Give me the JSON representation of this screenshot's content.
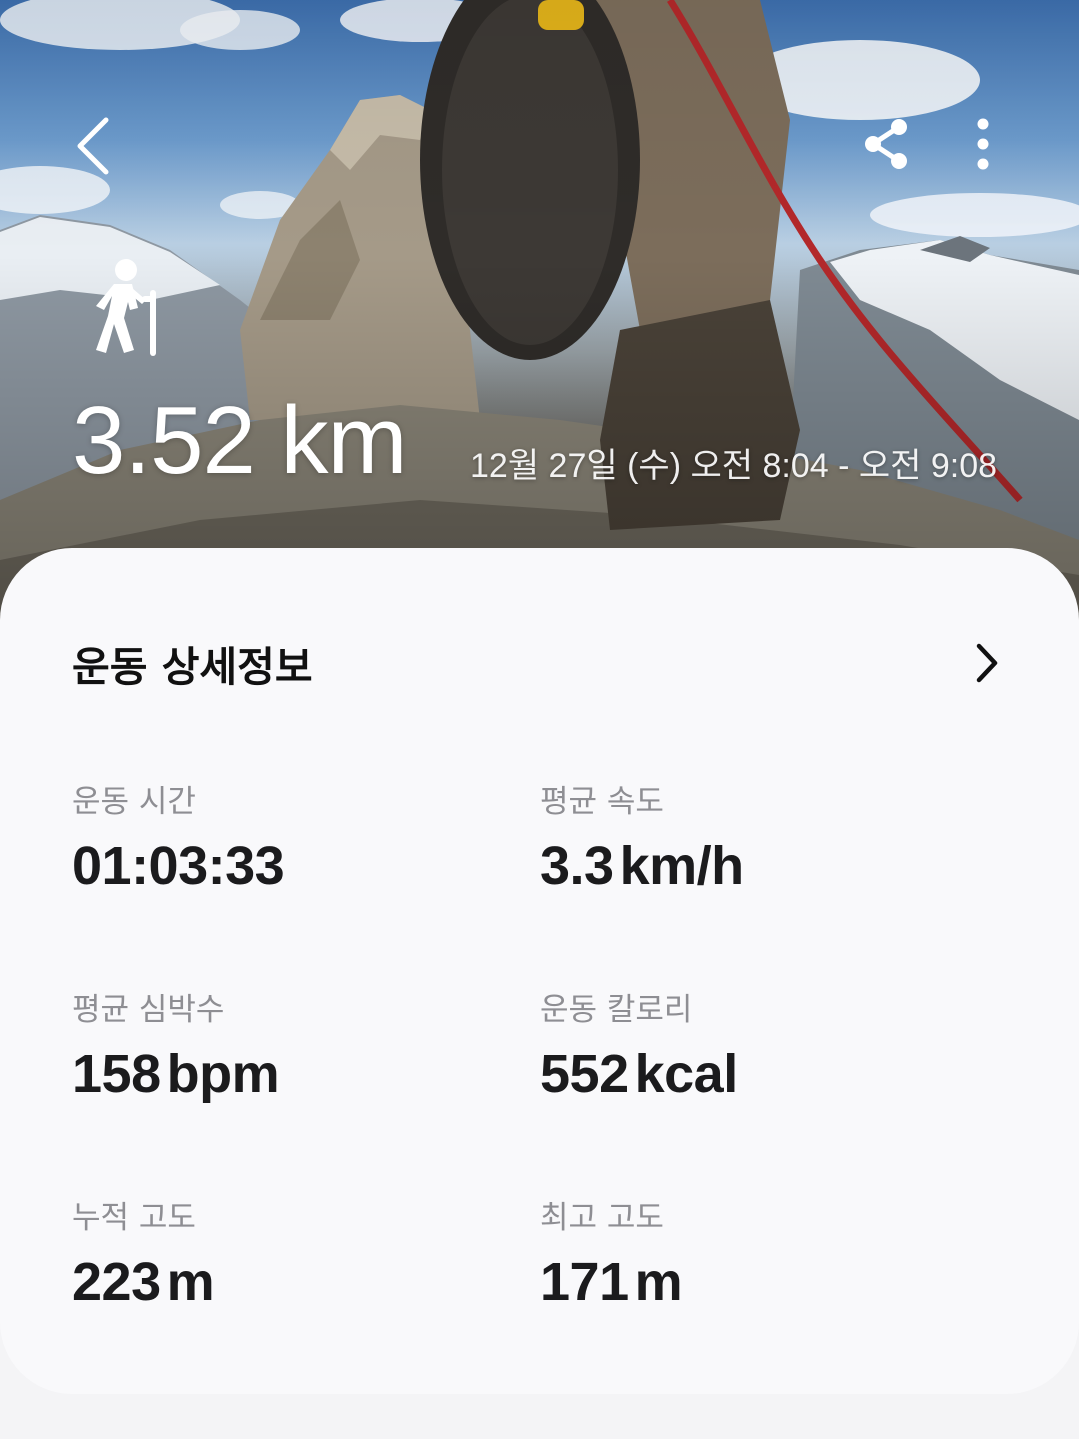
{
  "workout": {
    "distance": "3.52 km",
    "datetime": "12월 27일 (수) 오전 8:04 - 오전 9:08",
    "icon": "hiking-icon"
  },
  "toolbar": {
    "back_icon": "back-arrow-icon",
    "share_icon": "share-icon",
    "more_icon": "more-options-icon"
  },
  "details": {
    "title": "운동 상세정보",
    "chevron_icon": "chevron-right-icon",
    "stats": [
      {
        "label": "운동 시간",
        "value": "01:03:33",
        "unit": ""
      },
      {
        "label": "평균 속도",
        "value": "3.3",
        "unit": "km/h"
      },
      {
        "label": "평균 심박수",
        "value": "158",
        "unit": "bpm"
      },
      {
        "label": "운동 칼로리",
        "value": "552",
        "unit": "kcal"
      },
      {
        "label": "누적 고도",
        "value": "223",
        "unit": "m"
      },
      {
        "label": "최고 고도",
        "value": "171",
        "unit": "m"
      }
    ]
  },
  "colors": {
    "card_background": "#f9f9fb",
    "page_background": "#f4f4f6",
    "label_gray": "#8e8e93",
    "value_dark": "#1b1b1d",
    "hero_text": "#ffffff"
  }
}
